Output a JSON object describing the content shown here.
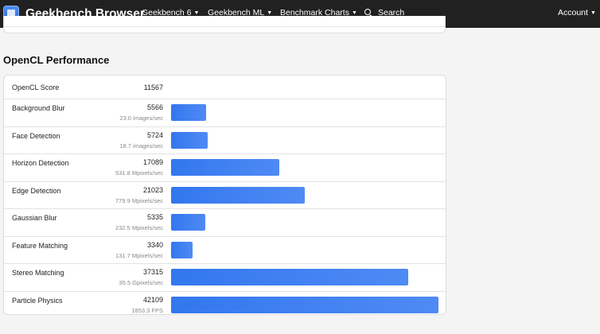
{
  "nav": {
    "brand": "Geekbench Browser",
    "items": [
      "Geekbench 6",
      "Geekbench ML",
      "Benchmark Charts"
    ],
    "search_label": "Search",
    "account_label": "Account"
  },
  "section": {
    "title": "OpenCL Performance",
    "score_label": "OpenCL Score",
    "score_value": "11567",
    "max_score": 42109,
    "rows": [
      {
        "name": "Background Blur",
        "score": 5566,
        "rate": "23.0 images/sec"
      },
      {
        "name": "Face Detection",
        "score": 5724,
        "rate": "18.7 images/sec"
      },
      {
        "name": "Horizon Detection",
        "score": 17089,
        "rate": "531.8 Mpixels/sec"
      },
      {
        "name": "Edge Detection",
        "score": 21023,
        "rate": "779.9 Mpixels/sec"
      },
      {
        "name": "Gaussian Blur",
        "score": 5335,
        "rate": "232.5 Mpixels/sec"
      },
      {
        "name": "Feature Matching",
        "score": 3340,
        "rate": "131.7 Mpixels/sec"
      },
      {
        "name": "Stereo Matching",
        "score": 37315,
        "rate": "35.5 Gpixels/sec"
      },
      {
        "name": "Particle Physics",
        "score": 42109,
        "rate": "1853.3 FPS"
      }
    ]
  }
}
